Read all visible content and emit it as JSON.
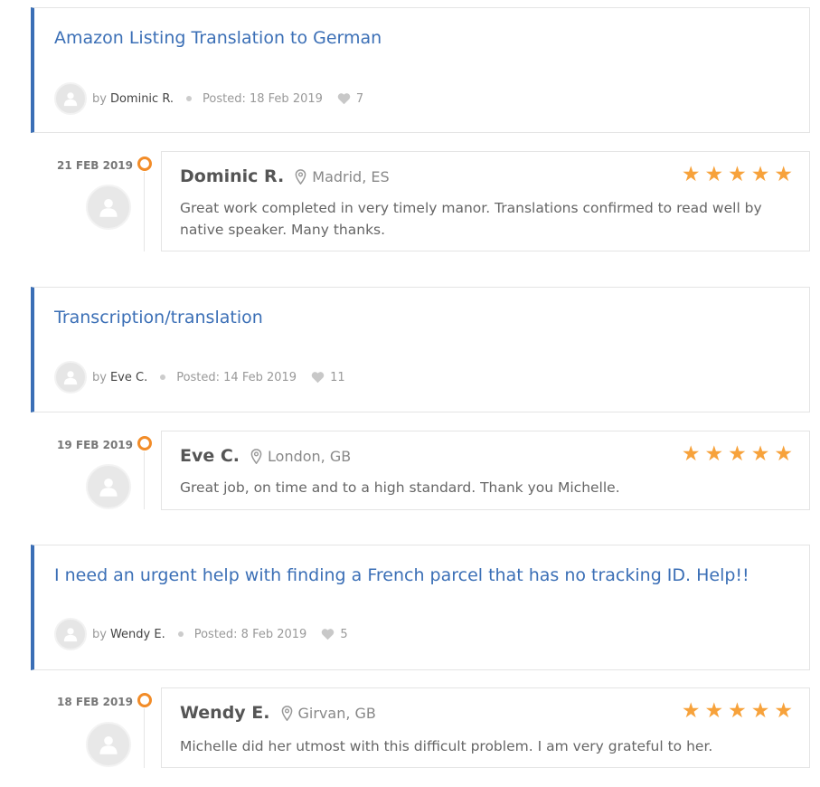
{
  "entries": [
    {
      "job_title": "Amazon Listing Translation to German",
      "by_label": "by",
      "author": "Dominic R.",
      "posted": "Posted: 18 Feb 2019",
      "likes": "7",
      "review_date": "21 FEB 2019",
      "reviewer": "Dominic R.",
      "location": "Madrid, ES",
      "rating": 5,
      "stars": "★★★★★",
      "text": "Great work completed in very timely manor. Translations confirmed to read well by native speaker. Many thanks."
    },
    {
      "job_title": "Transcription/translation",
      "by_label": "by",
      "author": "Eve C.",
      "posted": "Posted: 14 Feb 2019",
      "likes": "11",
      "review_date": "19 FEB 2019",
      "reviewer": "Eve C.",
      "location": "London, GB",
      "rating": 5,
      "stars": "★★★★★",
      "text": "Great job, on time and to a high standard. Thank you Michelle."
    },
    {
      "job_title": "I need an urgent help with finding a French parcel that has no tracking ID. Help!!",
      "by_label": "by",
      "author": "Wendy E.",
      "posted": "Posted: 8 Feb 2019",
      "likes": "5",
      "review_date": "18 FEB 2019",
      "reviewer": "Wendy E.",
      "location": "Girvan, GB",
      "rating": 5,
      "stars": "★★★★★",
      "text": "Michelle did her utmost with this difficult problem. I am very grateful to her."
    }
  ],
  "colors": {
    "accent_blue": "#3b6fb6",
    "star_orange": "#f7a23b",
    "timeline_orange": "#f28c28"
  },
  "icons": [
    "user-avatar-icon",
    "heart-icon",
    "location-pin-icon",
    "star-icon",
    "timeline-dot-icon"
  ]
}
